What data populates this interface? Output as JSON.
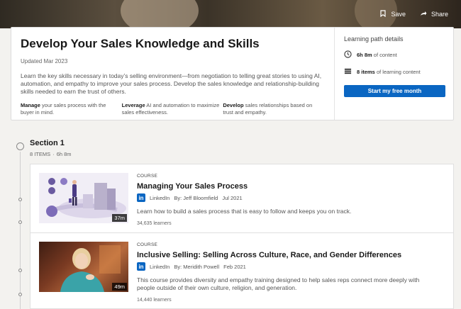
{
  "hero": {
    "save_label": "Save",
    "share_label": "Share"
  },
  "header": {
    "title": "Develop Your Sales Knowledge and Skills",
    "updated": "Updated Mar 2023",
    "description": "Learn the key skills necessary in today’s selling environment—from negotiation to telling great stories to using AI, automation, and empathy to improve your sales process. Develop the sales knowledge and relationship-building skills needed to earn the trust of others.",
    "features": [
      {
        "bold": "Manage",
        "text": " your sales process with the buyer in mind."
      },
      {
        "bold": "Leverage",
        "text": " AI and automation to maximize sales effectiveness."
      },
      {
        "bold": "Develop",
        "text": " sales relationships based on trust and empathy."
      }
    ]
  },
  "details": {
    "title": "Learning path details",
    "duration_value": "6h 8m",
    "duration_suffix": " of content",
    "items_value": "8 items",
    "items_suffix": " of learning content",
    "cta_label": "Start my free month"
  },
  "section": {
    "title": "Section 1",
    "items": "8 ITEMS",
    "duration": "6h 8m"
  },
  "courses": [
    {
      "kind": "COURSE",
      "title": "Managing Your Sales Process",
      "provider": "LinkedIn",
      "author": "By: Jeff Bloomfield",
      "date": "Jul 2021",
      "description": "Learn how to build a sales process that is easy to follow and keeps you on track.",
      "learners": "34,635 learners",
      "duration": "37m"
    },
    {
      "kind": "COURSE",
      "title": "Inclusive Selling: Selling Across Culture, Race, and Gender Differences",
      "provider": "LinkedIn",
      "author": "By: Meridith Powell",
      "date": "Feb 2021",
      "description": "This course provides diversity and empathy training designed to help sales reps connect more deeply with people outside of their own culture, religion, and generation.",
      "learners": "14,440 learners",
      "duration": "49m"
    }
  ],
  "colors": {
    "brand_blue": "#0a66c2",
    "page_bg": "#f3f2ef"
  },
  "icons": [
    "bookmark-icon",
    "share-icon",
    "clock-icon",
    "list-icon",
    "linkedin-icon"
  ]
}
